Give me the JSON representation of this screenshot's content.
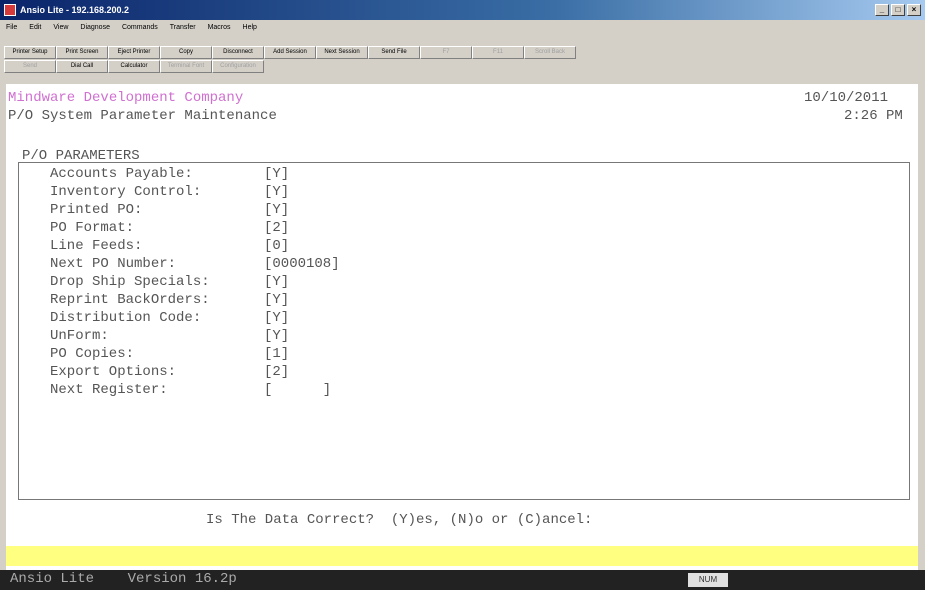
{
  "window": {
    "title": "Ansio Lite - 192.168.200.2",
    "buttons": [
      "_",
      "□",
      "×"
    ]
  },
  "menu": [
    "File",
    "Edit",
    "View",
    "Diagnose",
    "Commands",
    "Transfer",
    "Macros",
    "Help"
  ],
  "toolbar": {
    "row1": [
      "Printer Setup",
      "Print Screen",
      "Eject Printer",
      "Copy",
      "Disconnect",
      "Add Session",
      "Next Session",
      "Send File",
      "F7",
      "F11",
      "Scroll Back"
    ],
    "row2": [
      "Send",
      "Dial Call",
      "Calculator",
      "Terminal Font",
      "Configuration"
    ]
  },
  "screen": {
    "company": "Mindware Development Company",
    "date": "10/10/2011",
    "program": "P/O System Parameter Maintenance",
    "time": "2:26 PM",
    "section": "P/O PARAMETERS",
    "params": [
      {
        "label": "Accounts Payable:",
        "value": "[Y]"
      },
      {
        "label": "Inventory Control:",
        "value": "[Y]"
      },
      {
        "label": "Printed PO:",
        "value": "[Y]"
      },
      {
        "label": "PO Format:",
        "value": "[2]"
      },
      {
        "label": "Line Feeds:",
        "value": "[0]"
      },
      {
        "label": "Next PO Number:",
        "value": "[0000108]"
      },
      {
        "label": "Drop Ship Specials:",
        "value": "[Y]"
      },
      {
        "label": "Reprint BackOrders:",
        "value": "[Y]"
      },
      {
        "label": "Distribution Code:",
        "value": "[Y]"
      },
      {
        "label": "UnForm:",
        "value": "[Y]"
      },
      {
        "label": "PO Copies:",
        "value": "[1]"
      },
      {
        "label": "Export Options:",
        "value": "[2]"
      },
      {
        "label": "Next Register:",
        "value": "[      ]"
      }
    ],
    "prompt": "Is The Data Correct?  (Y)es, (N)o or (C)ancel:"
  },
  "status": {
    "version": "Ansio Lite    Version 16.2p",
    "num": "NUM"
  }
}
